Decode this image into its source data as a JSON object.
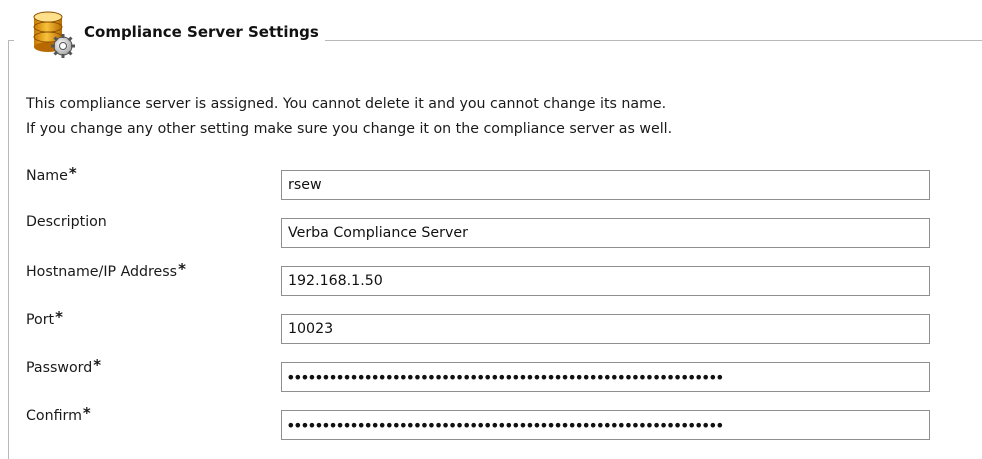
{
  "section": {
    "title": "Compliance Server Settings",
    "icon": "database-gear-icon"
  },
  "notice": {
    "line1": "This compliance server is assigned. You cannot delete it and you cannot change its name.",
    "line2": "If you change any other setting make sure you change it on the compliance server as well."
  },
  "form": {
    "required_marker": "*",
    "fields": [
      {
        "label": "Name",
        "required": true,
        "value": "rsew",
        "type": "text"
      },
      {
        "label": "Description",
        "required": false,
        "value": "Verba Compliance Server",
        "type": "text"
      },
      {
        "label": "Hostname/IP Address",
        "required": true,
        "value": "192.168.1.50",
        "type": "text"
      },
      {
        "label": "Port",
        "required": true,
        "value": "10023",
        "type": "text"
      },
      {
        "label": "Password",
        "required": true,
        "value": "••••••••••••••••••••••••••••••••••••••••••••••••••••••••••••••",
        "type": "password"
      },
      {
        "label": "Confirm",
        "required": true,
        "value": "••••••••••••••••••••••••••••••••••••••••••••••••••••••••••••••",
        "type": "password"
      }
    ]
  }
}
